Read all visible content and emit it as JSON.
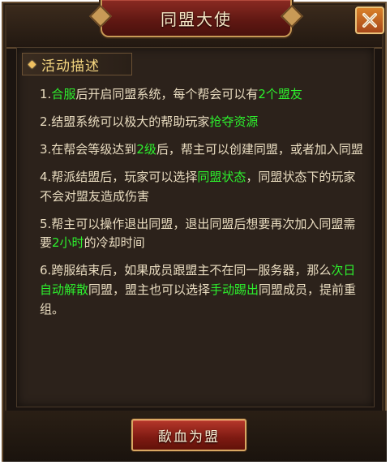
{
  "window": {
    "title": "同盟大使",
    "close_icon": "close-x-icon"
  },
  "section": {
    "title": "活动描述",
    "icon": "diamond-bullet-icon"
  },
  "description": [
    {
      "segments": [
        {
          "t": "1.",
          "hl": false
        },
        {
          "t": "合服",
          "hl": true
        },
        {
          "t": "后开启同盟系统，每个帮会可以有",
          "hl": false
        },
        {
          "t": "2个盟友",
          "hl": true
        }
      ]
    },
    {
      "segments": [
        {
          "t": "2.结盟系统可以极大的帮助玩家",
          "hl": false
        },
        {
          "t": "抢夺资源",
          "hl": true
        }
      ]
    },
    {
      "segments": [
        {
          "t": "3.在帮会等级达到",
          "hl": false
        },
        {
          "t": "2级",
          "hl": true
        },
        {
          "t": "后，帮主可以创建同盟，或者加入同盟",
          "hl": false
        }
      ]
    },
    {
      "segments": [
        {
          "t": "4.帮派结盟后，玩家可以选择",
          "hl": false
        },
        {
          "t": "同盟状态",
          "hl": true
        },
        {
          "t": "，同盟状态下的玩家不会对盟友造成伤害",
          "hl": false
        }
      ]
    },
    {
      "segments": [
        {
          "t": "5.帮主可以操作退出同盟，退出同盟后想要再次加入同盟需要",
          "hl": false
        },
        {
          "t": "2小时",
          "hl": true
        },
        {
          "t": "的冷却时间",
          "hl": false
        }
      ]
    },
    {
      "segments": [
        {
          "t": "6.跨服结束后，如果成员跟盟主不在同一服务器，那么",
          "hl": false
        },
        {
          "t": "次日自动解散",
          "hl": true
        },
        {
          "t": "同盟，盟主也可以选择",
          "hl": false
        },
        {
          "t": "手动踢出",
          "hl": true
        },
        {
          "t": "同盟成员，提前重组。",
          "hl": false
        }
      ]
    }
  ],
  "confirm_button": {
    "label": "歃血为盟"
  },
  "colors": {
    "highlight": "#2df02d",
    "text": "#e9dcc0",
    "section_title": "#f5d680",
    "button_red": "#7d1a12",
    "close_orange": "#d9822a"
  }
}
